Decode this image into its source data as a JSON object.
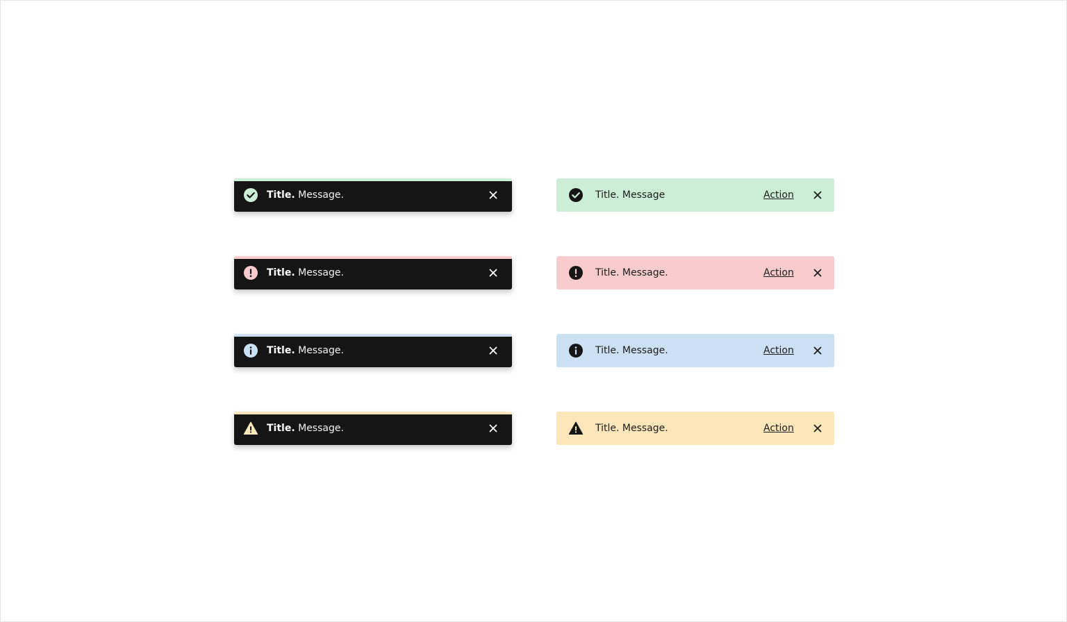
{
  "colors": {
    "dark_bg": "#151515",
    "success_light": "#cdeed6",
    "error_light": "#f8cccd",
    "info_light": "#cce0f4",
    "warning_light": "#fde6b9",
    "icon_dark": "#161616"
  },
  "dark_toasts": [
    {
      "type": "success",
      "icon": "check-circle-icon",
      "title": "Title.",
      "message": "Message.",
      "accent": "#cdeed6"
    },
    {
      "type": "error",
      "icon": "exclamation-circle-icon",
      "title": "Title.",
      "message": "Message.",
      "accent": "#f8cccd"
    },
    {
      "type": "info",
      "icon": "info-circle-icon",
      "title": "Title.",
      "message": "Message.",
      "accent": "#cce0f4"
    },
    {
      "type": "warning",
      "icon": "warning-triangle-icon",
      "title": "Title.",
      "message": "Message.",
      "accent": "#fde6b9"
    }
  ],
  "banners": [
    {
      "type": "success",
      "icon": "check-circle-icon",
      "text": "Title. Message",
      "action": "Action",
      "bg": "#cdeed6"
    },
    {
      "type": "error",
      "icon": "exclamation-circle-icon",
      "text": "Title. Message.",
      "action": "Action",
      "bg": "#f8cccd"
    },
    {
      "type": "info",
      "icon": "info-circle-icon",
      "text": "Title. Message.",
      "action": "Action",
      "bg": "#cce0f4"
    },
    {
      "type": "warning",
      "icon": "warning-triangle-icon",
      "text": "Title. Message.",
      "action": "Action",
      "bg": "#fde6b9"
    }
  ]
}
